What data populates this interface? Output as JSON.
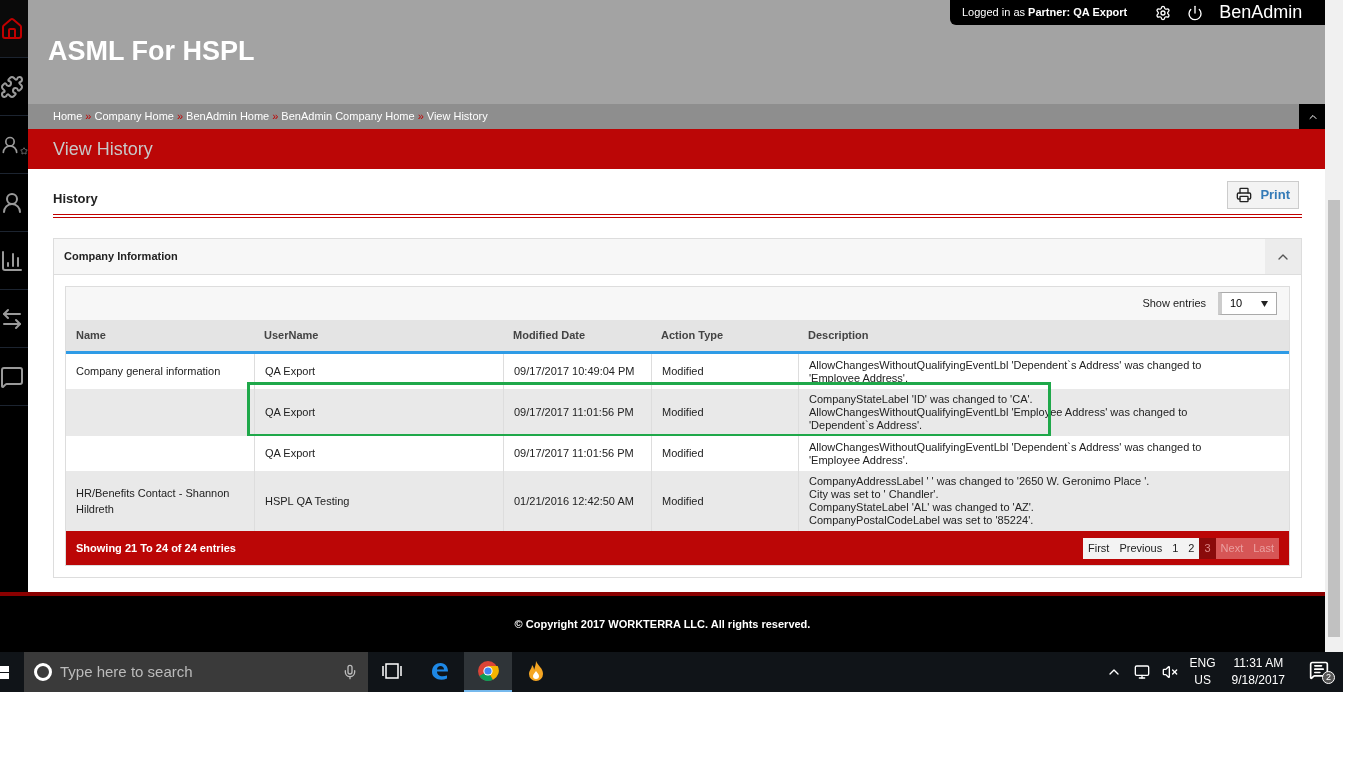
{
  "sidebar": {
    "items": [
      {
        "selected": true
      },
      {
        "selected": false
      },
      {
        "selected": false
      },
      {
        "selected": false
      },
      {
        "selected": false
      },
      {
        "selected": false
      },
      {
        "selected": false
      }
    ]
  },
  "header": {
    "title": "ASML For HSPL",
    "login": "Logged in as **Partner:  QA Export**",
    "user": "BenAdmin"
  },
  "breadcrumbs": [
    {
      "label": "Home"
    },
    {
      "separator": "»",
      "label": "Company Home"
    },
    {
      "separator": "»",
      "label": "BenAdmin Home"
    },
    {
      "separator": "»",
      "label": "BenAdmin Company Home"
    },
    {
      "separator": "»",
      "label": "View History"
    }
  ],
  "page_title": "View History",
  "section_title": "History",
  "print_button": "Print",
  "panel": {
    "title": "Company Information",
    "expanded": true,
    "show_entries_label": "Show entries",
    "show_entries_value": "10",
    "columns": [
      "Name",
      "UserName",
      "Modified Date",
      "Action Type",
      "Description"
    ],
    "rows": [
      {
        "name": "Company general information",
        "user": "QA Export",
        "date": "09/17/2017 10:49:04 PM",
        "action": "Modified",
        "description": [
          "AllowChangesWithoutQualifyingEventLbl 'Dependent`s Address' was changed to 'Employee Address'."
        ],
        "highlighted": false
      },
      {
        "name": "",
        "user": "QA Export",
        "date": "09/17/2017 11:01:56 PM",
        "action": "Modified",
        "description": [
          "CompanyStateLabel 'ID' was changed to 'CA'.",
          "AllowChangesWithoutQualifyingEventLbl 'Employee Address' was changed to 'Dependent`s Address'."
        ],
        "highlighted": true
      },
      {
        "name": "",
        "user": "QA Export",
        "date": "09/17/2017 11:01:56 PM",
        "action": "Modified",
        "description": [
          "AllowChangesWithoutQualifyingEventLbl 'Dependent`s Address' was changed to 'Employee Address'."
        ],
        "highlighted": false
      },
      {
        "name": "HR/Benefits Contact - Shannon Hildreth",
        "user": "HSPL QA Testing",
        "date": "01/21/2016 12:42:50 AM",
        "action": "Modified",
        "description": [
          "CompanyAddressLabel ' ' was changed to '2650 W. Geronimo Place '.",
          "City was set to ' Chandler'.",
          "CompanyStateLabel 'AL' was changed to 'AZ'.",
          "CompanyPostalCodeLabel was set to '85224'."
        ],
        "highlighted": false
      }
    ],
    "summary": "Showing 21 To 24 of 24 entries",
    "pagination": [
      {
        "label": "First",
        "selected": false,
        "disabled": false
      },
      {
        "label": "Previous",
        "selected": false,
        "disabled": false
      },
      {
        "label": "1",
        "selected": false,
        "disabled": false
      },
      {
        "label": "2",
        "selected": false,
        "disabled": false
      },
      {
        "label": "3",
        "selected": true,
        "disabled": false
      },
      {
        "label": "Next",
        "selected": false,
        "disabled": true
      },
      {
        "label": "Last",
        "selected": false,
        "disabled": true
      }
    ]
  },
  "footer": "© Copyright 2017 WORKTERRA LLC. All rights reserved.",
  "taskbar": {
    "search_placeholder": "Type here to search",
    "apps": [
      {
        "active": false
      },
      {
        "active": false
      },
      {
        "active": true
      },
      {
        "active": false
      }
    ],
    "language": "ENG",
    "region": "US",
    "time": "11:31 AM",
    "date": "9/18/2017",
    "notifications": "2"
  }
}
